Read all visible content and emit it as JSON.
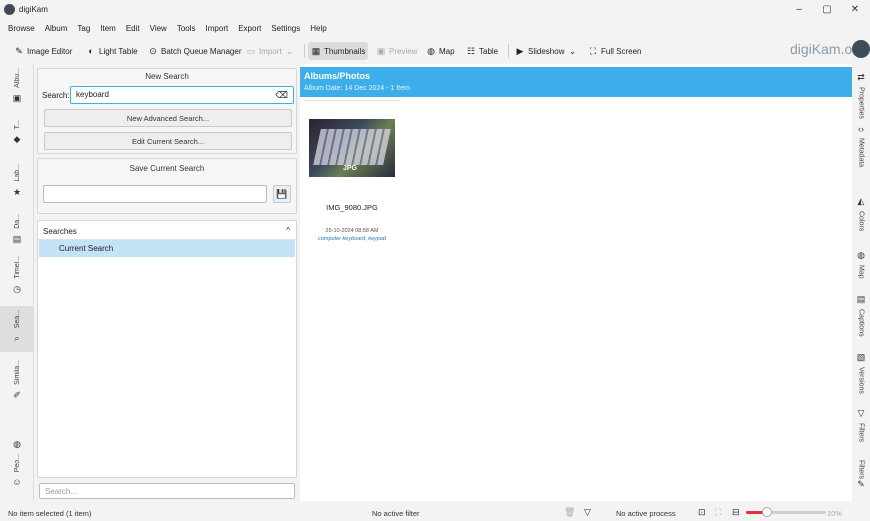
{
  "window": {
    "title": "digiKam",
    "minimize_glyph": "–",
    "maximize_glyph": "▢",
    "close_glyph": "✕"
  },
  "menu": [
    "Browse",
    "Album",
    "Tag",
    "Item",
    "Edit",
    "View",
    "Tools",
    "Import",
    "Export",
    "Settings",
    "Help"
  ],
  "toolbar": {
    "image_editor": "Image Editor",
    "light_table": "Light Table",
    "batch_queue": "Batch Queue Manager",
    "import": "Import",
    "thumbnails": "Thumbnails",
    "preview": "Preview",
    "map": "Map",
    "table": "Table",
    "slideshow": "Slideshow",
    "full_screen": "Full Screen",
    "brand": "digiKam.org"
  },
  "left_tabs": {
    "albums": "Albu...",
    "tags": "T...",
    "labels": "Lab...",
    "dates": "Da...",
    "timeline": "Timel...",
    "search": "Sea...",
    "similarity": "Simila...",
    "people": "Peo..."
  },
  "search_panel": {
    "new_search_title": "New Search",
    "search_label": "Search:",
    "search_value": "keyboard",
    "new_advanced": "New Advanced Search...",
    "edit_current": "Edit Current Search...",
    "save_title": "Save Current Search",
    "save_value": "",
    "searches_header": "Searches",
    "collapse_glyph": "^",
    "current_search": "Current Search",
    "filter_placeholder": "Search..."
  },
  "album": {
    "title": "Albums/Photos",
    "subtitle": "Album Date: 14 Dec 2024 - 1 Item",
    "item": {
      "badge": "JPG",
      "filename": "IMG_9080.JPG",
      "datetime": "25-10-2024 08:58 AM",
      "tags": "computer keyboard, keypad"
    }
  },
  "right_tabs": {
    "properties": "Properties",
    "metadata": "Metadata",
    "colors": "Colors",
    "map": "Map",
    "captions": "Captions",
    "versions": "Versions",
    "filters_1": "Filters",
    "filters_2": "Filters"
  },
  "status": {
    "selection": "No item selected (1 item)",
    "filter": "No active filter",
    "process": "No active process",
    "zoom": "10%"
  },
  "colors": {
    "accent": "#3daee9",
    "zoom_slider": "#e0303c"
  }
}
